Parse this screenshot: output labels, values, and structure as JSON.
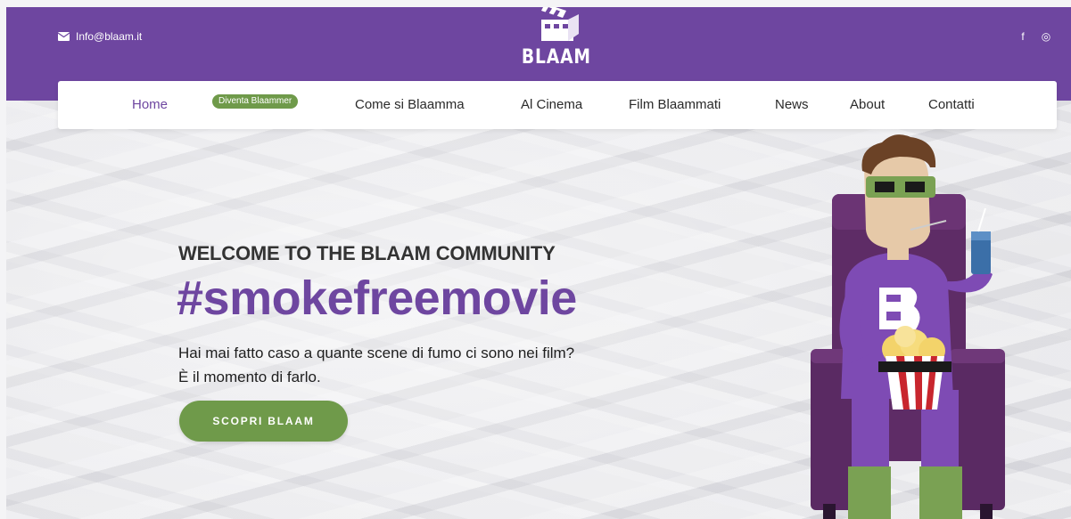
{
  "header": {
    "email": "Info@blaam.it",
    "logo_text": "BLAAM",
    "social": [
      {
        "icon": "facebook-icon",
        "glyph": "f"
      },
      {
        "icon": "instagram-icon",
        "glyph": "◎"
      }
    ]
  },
  "nav": {
    "items": [
      {
        "label": "Home",
        "active": true
      },
      {
        "label": "Diventa Blaammer",
        "pill": true
      },
      {
        "label": "Come si Blaamma"
      },
      {
        "label": "Al Cinema"
      },
      {
        "label": "Film Blaammati"
      },
      {
        "label": "News"
      },
      {
        "label": "About"
      },
      {
        "label": "Contatti"
      }
    ]
  },
  "hero": {
    "welcome": "WELCOME TO THE BLAAM COMMUNITY",
    "hashtag": "#smokefreemovie",
    "line1": "Hai mai fatto caso a quante scene di fumo ci sono nei film?",
    "line2": "È il momento di farlo.",
    "cta": "SCOPRI BLAAM"
  },
  "colors": {
    "brand_purple": "#6e46a0",
    "cta_green": "#6f9a4a",
    "white": "#ffffff"
  }
}
